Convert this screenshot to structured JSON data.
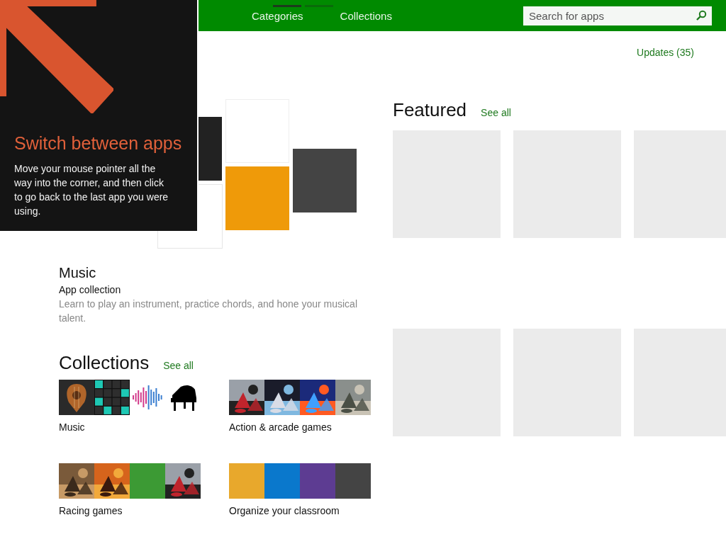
{
  "tip": {
    "title": "Switch between apps",
    "body": "Move your mouse pointer all the way into the corner, and then click to go back to the last app you were using."
  },
  "nav": {
    "indicators": [
      {
        "selected": true
      },
      {
        "selected": false
      }
    ],
    "tabs": [
      {
        "label": "Categories"
      },
      {
        "label": "Collections"
      }
    ],
    "search": {
      "placeholder": "Search for apps"
    }
  },
  "updates": "Updates (35)",
  "hero": {
    "title": "Music",
    "subtitle": "App collection",
    "description": "Learn to play an instrument, practice chords, and hone your musical talent."
  },
  "collections": {
    "title": "Collections",
    "see_all": "See all",
    "items": [
      {
        "label": "Music",
        "thumbs": [
          {
            "kind": "guitar"
          },
          {
            "kind": "pads"
          },
          {
            "kind": "waveform"
          },
          {
            "kind": "piano"
          }
        ]
      },
      {
        "label": "Action & arcade games",
        "thumbs": [
          {
            "kind": "picture"
          },
          {
            "kind": "picture"
          },
          {
            "kind": "picture"
          },
          {
            "kind": "picture"
          }
        ]
      },
      {
        "label": "Racing games",
        "thumbs": [
          {
            "kind": "picture"
          },
          {
            "kind": "picture"
          },
          {
            "kind": "color",
            "color": "#3c9a34"
          },
          {
            "kind": "picture"
          }
        ]
      },
      {
        "label": "Organize your classroom",
        "thumbs": [
          {
            "kind": "color",
            "color": "#e8a82c"
          },
          {
            "kind": "color",
            "color": "#0a78cc"
          },
          {
            "kind": "color",
            "color": "#5d3c92"
          },
          {
            "kind": "color",
            "color": "#444444"
          }
        ]
      }
    ]
  },
  "featured": {
    "title": "Featured",
    "see_all": "See all"
  }
}
